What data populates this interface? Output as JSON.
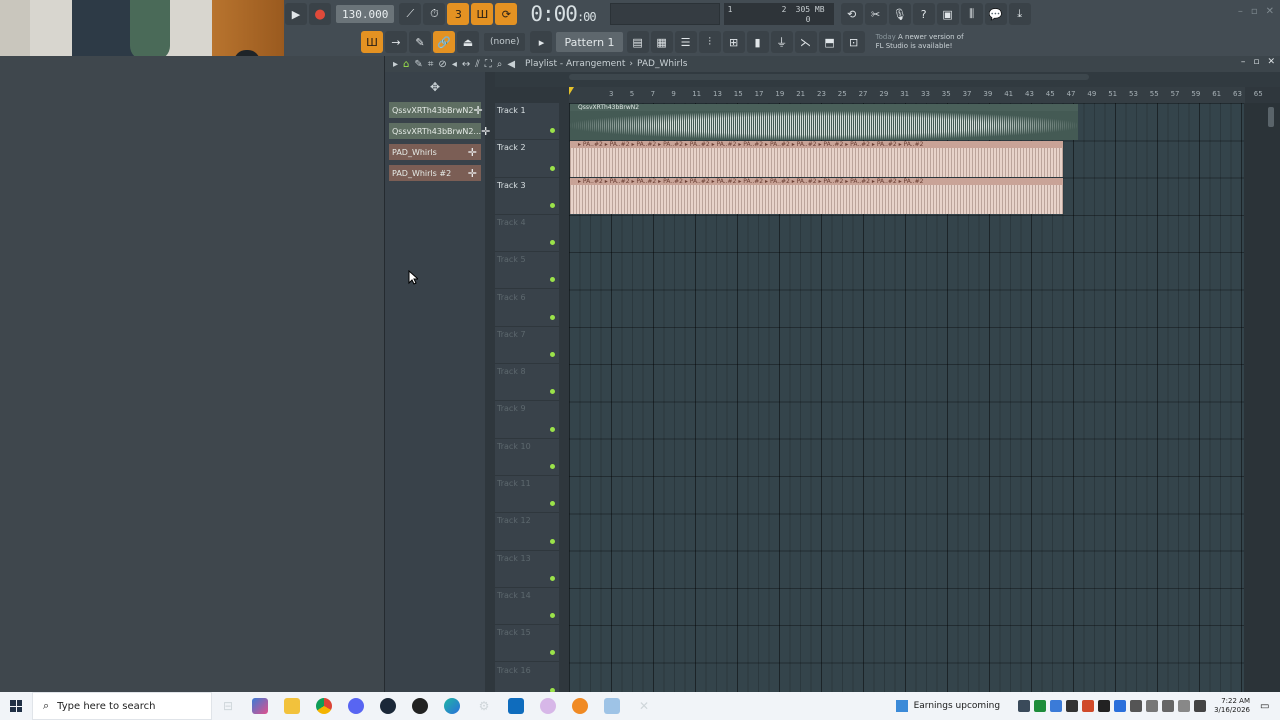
{
  "toolbar": {
    "tempo": "130.000",
    "time_main": "0:00",
    "time_sub": "00",
    "time_format": "M:S:CS",
    "cpu": {
      "a": "1",
      "b": "2",
      "mem": "305 MB",
      "c": "0",
      "d": "0"
    },
    "snap": "(none)",
    "pattern": "Pattern 1",
    "news_label": "Today",
    "news_text": "A newer version of",
    "news_text2": "FL Studio is available!"
  },
  "playlist": {
    "title": "Playlist - Arrangement",
    "crumb_sep": "›",
    "current": "PAD_Whirls",
    "clips": [
      {
        "label": "QssvXRTh43bBrwN2",
        "kind": "audio"
      },
      {
        "label": "QssvXRTh43bBrwN2...",
        "kind": "audio"
      },
      {
        "label": "PAD_Whirls",
        "kind": "pat"
      },
      {
        "label": "PAD_Whirls #2",
        "kind": "pat"
      }
    ],
    "tracks": [
      "Track 1",
      "Track 2",
      "Track 3",
      "Track 4",
      "Track 5",
      "Track 6",
      "Track 7",
      "Track 8",
      "Track 9",
      "Track 10",
      "Track 11",
      "Track 12",
      "Track 13",
      "Track 14",
      "Track 15",
      "Track 16"
    ],
    "ruler": [
      "3",
      "5",
      "7",
      "9",
      "11",
      "13",
      "15",
      "17",
      "19",
      "21",
      "23",
      "25",
      "27",
      "29",
      "31",
      "33",
      "35",
      "37",
      "39",
      "41",
      "43",
      "45",
      "47",
      "49",
      "51",
      "53",
      "55",
      "57",
      "59",
      "61",
      "63",
      "65"
    ],
    "track1_clip": "QssvXRTh43bBrwN2",
    "track2_clip": "PA..#2",
    "track3_clip": "PA..#2"
  },
  "taskbar": {
    "search_placeholder": "Type here to search",
    "news": "Earnings upcoming",
    "time": "7:22 AM",
    "date": "3/16/2026"
  }
}
